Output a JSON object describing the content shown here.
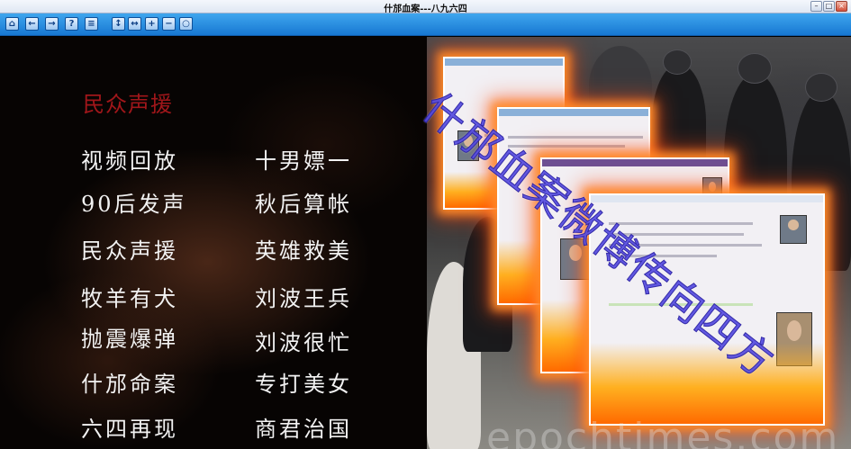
{
  "window": {
    "title": "什邡血案---八九六四",
    "buttons": {
      "minimize": "–",
      "restore": "□",
      "close": "×"
    }
  },
  "toolbar": [
    {
      "name": "home-icon",
      "glyph": "⌂"
    },
    {
      "name": "back-icon",
      "glyph": "←"
    },
    {
      "name": "forward-icon",
      "glyph": "→"
    },
    {
      "name": "help-icon",
      "glyph": "?"
    },
    {
      "name": "contents-icon",
      "glyph": "≡"
    },
    {
      "name": "fit-height-icon",
      "glyph": "↕"
    },
    {
      "name": "fit-width-icon",
      "glyph": "↔"
    },
    {
      "name": "zoom-in-icon",
      "glyph": "+"
    },
    {
      "name": "zoom-out-icon",
      "glyph": "−"
    },
    {
      "name": "zoom-reset-icon",
      "glyph": "○"
    }
  ],
  "section_title": "民众声援",
  "menu": {
    "col1": [
      "视频回放",
      "90后发声",
      "民众声援",
      "牧羊有犬",
      "抛震爆弹",
      "什邡命案",
      "六四再现"
    ],
    "col2": [
      "十男嫖一",
      "秋后算帐",
      "英雄救美",
      "刘波王兵",
      "刘波很忙",
      "专打美女",
      "商君治国"
    ]
  },
  "overlay_text": "什邡血案微博传向四方",
  "watermark_text": "epochtimes.com"
}
